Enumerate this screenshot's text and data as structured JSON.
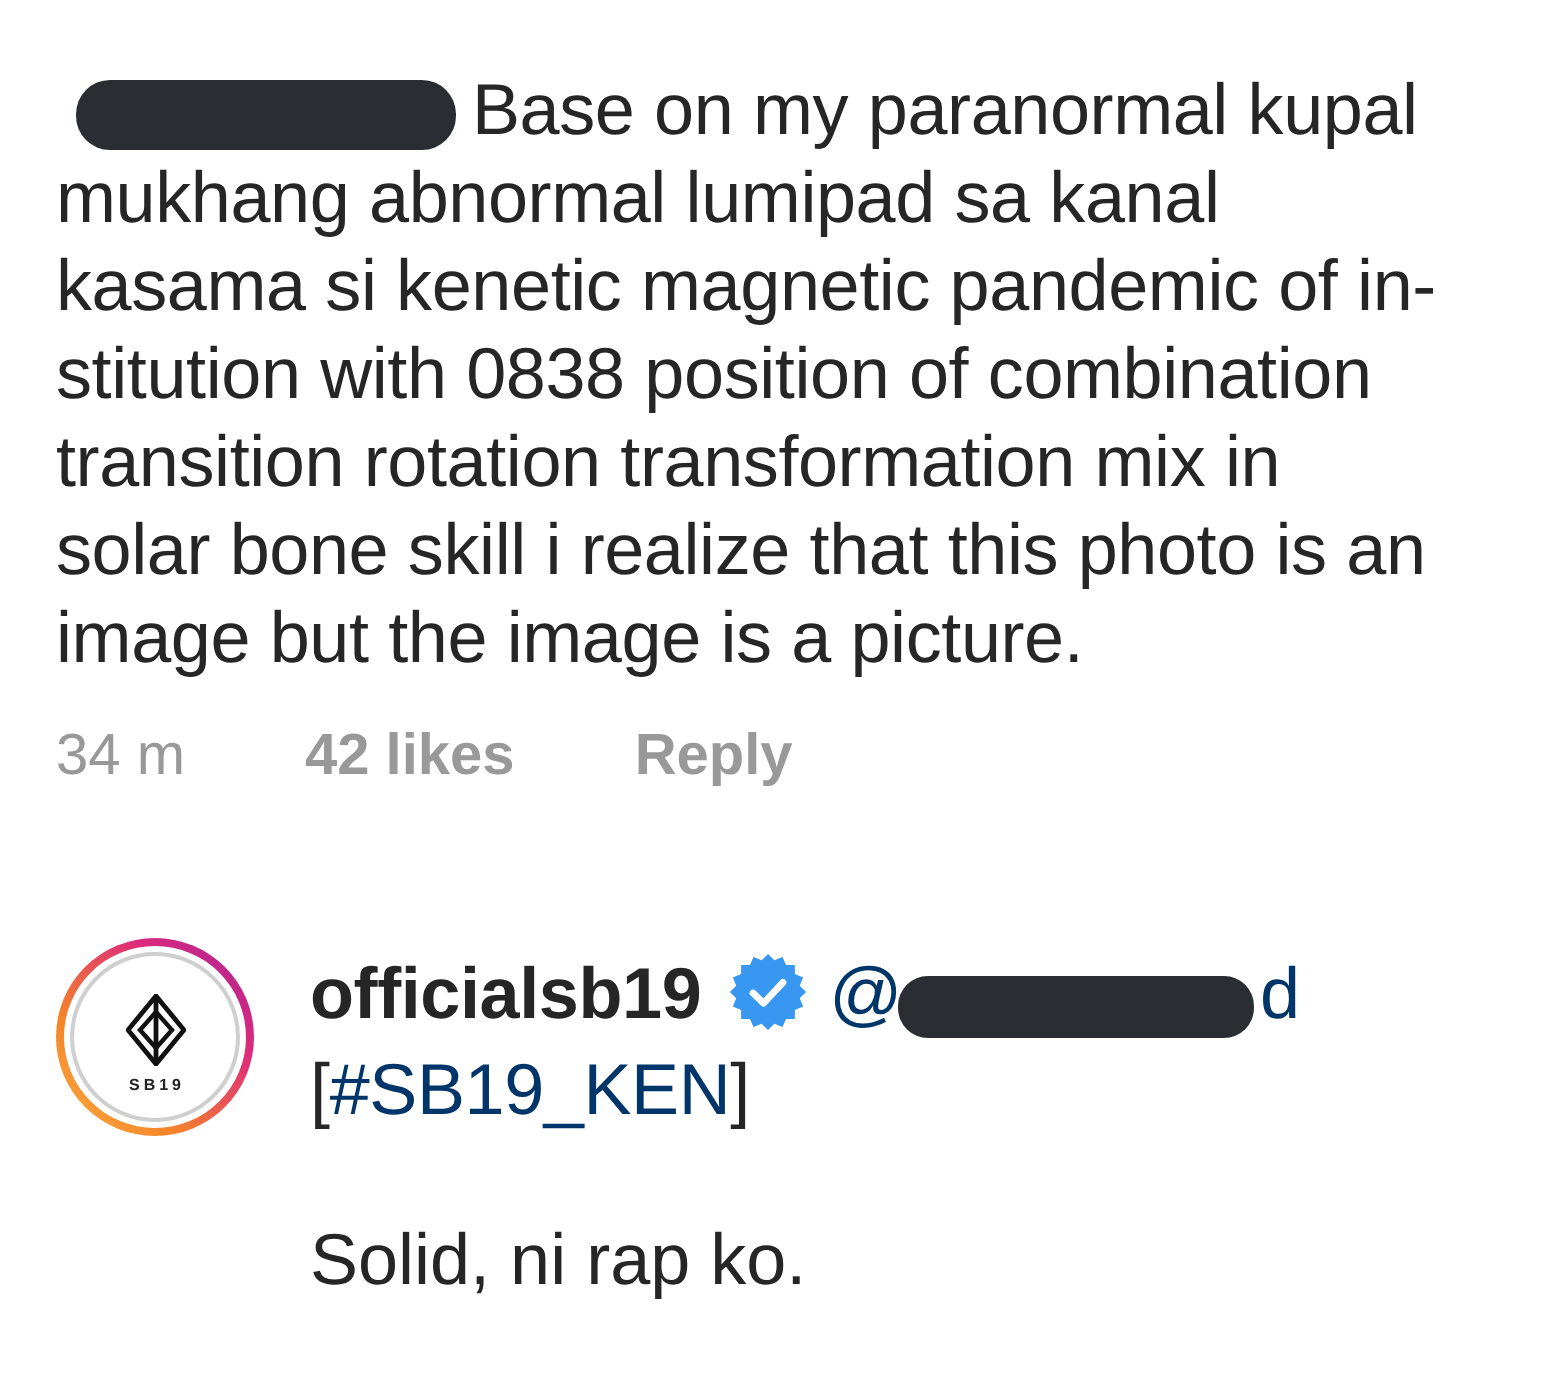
{
  "comment": {
    "author": {
      "redacted": true
    },
    "lines": [
      "Base on my paranormal kupal",
      "mukhang abnormal lumipad sa kanal",
      "kasama si kenetic magnetic pandemic of in-",
      "stitution with 0838 position of combination",
      "transition rotation transformation mix in",
      "solar bone skill i realize that this photo is an",
      "image but the image is a picture."
    ]
  },
  "meta": {
    "time": "34 m",
    "likes": "42 likes",
    "reply_label": "Reply"
  },
  "reply": {
    "avatar": {
      "story_ring": true,
      "logo_text": "SB19"
    },
    "username": "officialsb19",
    "verified": true,
    "mention": {
      "start": "@",
      "redacted": true,
      "end": "d"
    },
    "tag_open": "[",
    "hashtag": "#SB19_KEN",
    "tag_close": "]",
    "message": "Solid, ni rap ko."
  }
}
